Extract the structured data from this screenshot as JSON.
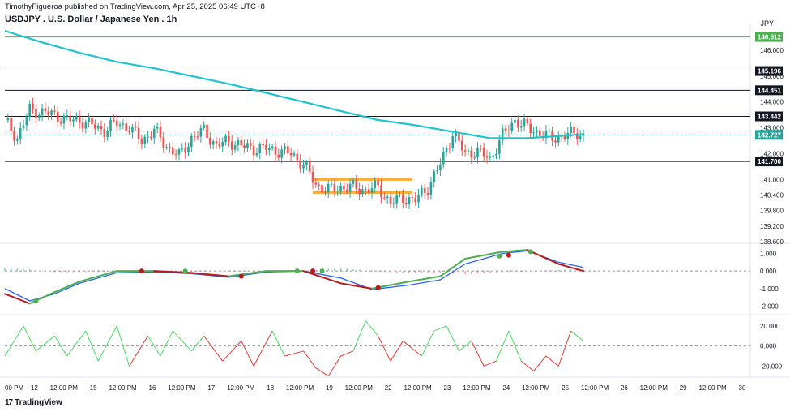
{
  "header": {
    "publisher_line": "TimothyFigueroa published on TradingView.com, Apr 25, 2025 06:49 UTC+8",
    "title": "USDJPY . U.S. Dollar / Japanese Yen . 1h",
    "currency": "JPY"
  },
  "footer": {
    "logo_mark": "17",
    "brand": "TradingView"
  },
  "colors": {
    "up": "#26a69a",
    "down": "#ef5350",
    "ma": "#1fc4cc",
    "level_green": "#4caf50",
    "orange": "#ff9800",
    "macd": "#2962ff",
    "signal_green": "#4caf50",
    "signal_red": "#b71c1c",
    "osc_green": "#4cd964",
    "osc_red": "#e53935"
  },
  "chart_data": [
    {
      "type": "candlestick",
      "name": "price",
      "ylim": [
        138.6,
        147.0
      ],
      "y_ticks": [
        "146.000",
        "145.000",
        "144.000",
        "143.000",
        "142.000",
        "141.000",
        "140.400",
        "139.800",
        "139.200",
        "138.600"
      ],
      "x_ticks": [
        "00 PM",
        "12",
        "12:00 PM",
        "15",
        "12:00 PM",
        "16",
        "12:00 PM",
        "17",
        "12:00 PM",
        "18",
        "12:00 PM",
        "19",
        "12:00 PM",
        "22",
        "12:00 PM",
        "23",
        "12:00 PM",
        "24",
        "12:00 PM",
        "25",
        "12:00 PM",
        "26",
        "12:00 PM",
        "29",
        "12:00 PM",
        "30"
      ],
      "levels": [
        {
          "value": 146.512,
          "label": "146.512",
          "style": "green"
        },
        {
          "value": 145.196,
          "label": "145.196",
          "style": "black"
        },
        {
          "value": 144.451,
          "label": "144.451",
          "style": "black"
        },
        {
          "value": 143.442,
          "label": "143.442",
          "style": "black"
        },
        {
          "value": 141.7,
          "label": "141.700",
          "style": "black"
        }
      ],
      "last_price": {
        "value": 142.727,
        "label": "142.727"
      },
      "zone_lines": [
        141.0,
        140.5
      ],
      "close_path": [
        [
          0,
          143.3
        ],
        [
          4,
          142.6
        ],
        [
          8,
          143.7
        ],
        [
          12,
          143.6
        ],
        [
          16,
          143.5
        ],
        [
          20,
          143.3
        ],
        [
          24,
          143.3
        ],
        [
          28,
          143.1
        ],
        [
          32,
          142.9
        ],
        [
          36,
          143.2
        ],
        [
          40,
          143.0
        ],
        [
          44,
          142.5
        ],
        [
          48,
          142.9
        ],
        [
          52,
          142.3
        ],
        [
          56,
          141.9
        ],
        [
          60,
          142.6
        ],
        [
          64,
          142.9
        ],
        [
          68,
          142.3
        ],
        [
          72,
          142.5
        ],
        [
          76,
          142.3
        ],
        [
          80,
          142.2
        ],
        [
          84,
          142.2
        ],
        [
          88,
          142.1
        ],
        [
          92,
          142.0
        ],
        [
          96,
          141.6
        ],
        [
          100,
          140.8
        ],
        [
          104,
          140.6
        ],
        [
          108,
          140.7
        ],
        [
          112,
          140.7
        ],
        [
          116,
          140.6
        ],
        [
          120,
          140.7
        ],
        [
          124,
          140.1
        ],
        [
          128,
          140.3
        ],
        [
          132,
          140.2
        ],
        [
          136,
          140.7
        ],
        [
          140,
          141.6
        ],
        [
          144,
          142.8
        ],
        [
          148,
          142.0
        ],
        [
          152,
          142.1
        ],
        [
          156,
          141.8
        ],
        [
          160,
          142.7
        ],
        [
          164,
          143.3
        ],
        [
          168,
          143.0
        ],
        [
          172,
          142.8
        ],
        [
          176,
          142.6
        ],
        [
          180,
          142.7
        ],
        [
          184,
          142.8
        ],
        [
          186,
          142.7
        ]
      ],
      "ma_path": [
        [
          0,
          146.75
        ],
        [
          12,
          146.3
        ],
        [
          24,
          145.9
        ],
        [
          36,
          145.55
        ],
        [
          48,
          145.3
        ],
        [
          60,
          145.0
        ],
        [
          72,
          144.7
        ],
        [
          84,
          144.35
        ],
        [
          96,
          144.0
        ],
        [
          108,
          143.65
        ],
        [
          120,
          143.3
        ],
        [
          132,
          143.1
        ],
        [
          144,
          142.85
        ],
        [
          156,
          142.6
        ],
        [
          168,
          142.6
        ],
        [
          180,
          142.7
        ],
        [
          186,
          142.75
        ]
      ],
      "x_count": 186
    },
    {
      "type": "line",
      "name": "macd",
      "ylim": [
        -2.3,
        1.3
      ],
      "y_ticks": [
        "1.000",
        "0.000",
        "-1.000",
        "-2.000"
      ],
      "macd": [
        [
          0,
          -1.0
        ],
        [
          8,
          -1.7
        ],
        [
          16,
          -1.3
        ],
        [
          24,
          -0.7
        ],
        [
          36,
          -0.1
        ],
        [
          48,
          -0.05
        ],
        [
          60,
          -0.15
        ],
        [
          72,
          -0.35
        ],
        [
          84,
          -0.05
        ],
        [
          96,
          0.0
        ],
        [
          108,
          -0.4
        ],
        [
          118,
          -1.05
        ],
        [
          130,
          -0.8
        ],
        [
          140,
          -0.5
        ],
        [
          148,
          0.4
        ],
        [
          160,
          1.0
        ],
        [
          168,
          1.15
        ],
        [
          178,
          0.5
        ],
        [
          186,
          0.2
        ]
      ],
      "signal": [
        [
          0,
          -1.3
        ],
        [
          8,
          -1.85
        ],
        [
          16,
          -1.2
        ],
        [
          24,
          -0.6
        ],
        [
          36,
          0.0
        ],
        [
          48,
          0.0
        ],
        [
          60,
          -0.1
        ],
        [
          72,
          -0.3
        ],
        [
          84,
          0.0
        ],
        [
          96,
          0.0
        ],
        [
          108,
          -0.7
        ],
        [
          118,
          -1.0
        ],
        [
          130,
          -0.6
        ],
        [
          140,
          -0.3
        ],
        [
          148,
          0.7
        ],
        [
          160,
          1.1
        ],
        [
          168,
          1.2
        ],
        [
          178,
          0.4
        ],
        [
          186,
          0.0
        ]
      ],
      "cross_points": [
        [
          10,
          -1.7
        ],
        [
          44,
          0.0
        ],
        [
          58,
          0.0
        ],
        [
          76,
          -0.3
        ],
        [
          94,
          0.0
        ],
        [
          99,
          0.0
        ],
        [
          102,
          0.0
        ],
        [
          120,
          -0.95
        ],
        [
          159,
          0.85
        ],
        [
          162,
          0.9
        ],
        [
          169,
          1.1
        ]
      ]
    },
    {
      "type": "line",
      "name": "oscillator",
      "ylim": [
        -27,
        28
      ],
      "y_ticks": [
        "20.000",
        "0.000",
        "-20.000"
      ],
      "values": [
        [
          0,
          -10
        ],
        [
          6,
          20
        ],
        [
          10,
          -5
        ],
        [
          16,
          10
        ],
        [
          20,
          -10
        ],
        [
          26,
          15
        ],
        [
          30,
          -15
        ],
        [
          36,
          20
        ],
        [
          40,
          -20
        ],
        [
          46,
          10
        ],
        [
          50,
          -10
        ],
        [
          54,
          15
        ],
        [
          60,
          -5
        ],
        [
          64,
          10
        ],
        [
          70,
          -15
        ],
        [
          76,
          5
        ],
        [
          80,
          -20
        ],
        [
          86,
          15
        ],
        [
          90,
          -10
        ],
        [
          96,
          -5
        ],
        [
          100,
          -22
        ],
        [
          104,
          -30
        ],
        [
          108,
          -10
        ],
        [
          112,
          -5
        ],
        [
          116,
          25
        ],
        [
          120,
          10
        ],
        [
          124,
          -15
        ],
        [
          128,
          5
        ],
        [
          134,
          -10
        ],
        [
          138,
          15
        ],
        [
          142,
          20
        ],
        [
          146,
          -5
        ],
        [
          150,
          5
        ],
        [
          154,
          -20
        ],
        [
          158,
          -15
        ],
        [
          162,
          15
        ],
        [
          166,
          -15
        ],
        [
          170,
          -25
        ],
        [
          174,
          -10
        ],
        [
          178,
          -20
        ],
        [
          182,
          15
        ],
        [
          186,
          5
        ]
      ]
    }
  ]
}
